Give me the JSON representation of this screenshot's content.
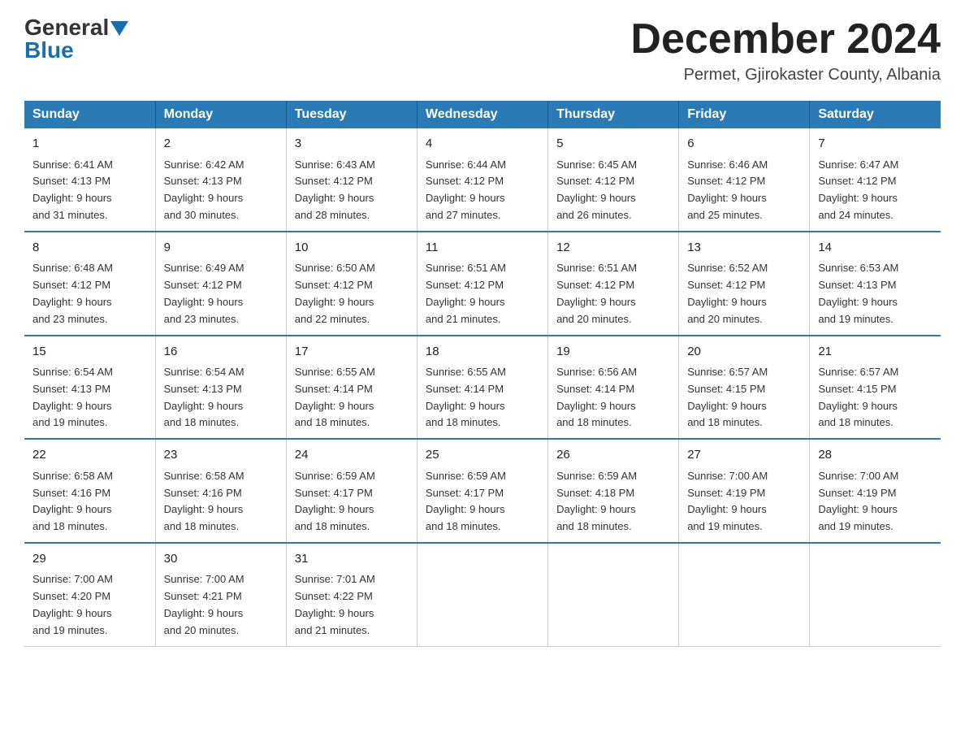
{
  "logo": {
    "general": "General",
    "blue": "Blue"
  },
  "title": "December 2024",
  "location": "Permet, Gjirokaster County, Albania",
  "days_of_week": [
    "Sunday",
    "Monday",
    "Tuesday",
    "Wednesday",
    "Thursday",
    "Friday",
    "Saturday"
  ],
  "weeks": [
    [
      {
        "day": "1",
        "sunrise": "6:41 AM",
        "sunset": "4:13 PM",
        "daylight": "9 hours and 31 minutes."
      },
      {
        "day": "2",
        "sunrise": "6:42 AM",
        "sunset": "4:13 PM",
        "daylight": "9 hours and 30 minutes."
      },
      {
        "day": "3",
        "sunrise": "6:43 AM",
        "sunset": "4:12 PM",
        "daylight": "9 hours and 28 minutes."
      },
      {
        "day": "4",
        "sunrise": "6:44 AM",
        "sunset": "4:12 PM",
        "daylight": "9 hours and 27 minutes."
      },
      {
        "day": "5",
        "sunrise": "6:45 AM",
        "sunset": "4:12 PM",
        "daylight": "9 hours and 26 minutes."
      },
      {
        "day": "6",
        "sunrise": "6:46 AM",
        "sunset": "4:12 PM",
        "daylight": "9 hours and 25 minutes."
      },
      {
        "day": "7",
        "sunrise": "6:47 AM",
        "sunset": "4:12 PM",
        "daylight": "9 hours and 24 minutes."
      }
    ],
    [
      {
        "day": "8",
        "sunrise": "6:48 AM",
        "sunset": "4:12 PM",
        "daylight": "9 hours and 23 minutes."
      },
      {
        "day": "9",
        "sunrise": "6:49 AM",
        "sunset": "4:12 PM",
        "daylight": "9 hours and 23 minutes."
      },
      {
        "day": "10",
        "sunrise": "6:50 AM",
        "sunset": "4:12 PM",
        "daylight": "9 hours and 22 minutes."
      },
      {
        "day": "11",
        "sunrise": "6:51 AM",
        "sunset": "4:12 PM",
        "daylight": "9 hours and 21 minutes."
      },
      {
        "day": "12",
        "sunrise": "6:51 AM",
        "sunset": "4:12 PM",
        "daylight": "9 hours and 20 minutes."
      },
      {
        "day": "13",
        "sunrise": "6:52 AM",
        "sunset": "4:12 PM",
        "daylight": "9 hours and 20 minutes."
      },
      {
        "day": "14",
        "sunrise": "6:53 AM",
        "sunset": "4:13 PM",
        "daylight": "9 hours and 19 minutes."
      }
    ],
    [
      {
        "day": "15",
        "sunrise": "6:54 AM",
        "sunset": "4:13 PM",
        "daylight": "9 hours and 19 minutes."
      },
      {
        "day": "16",
        "sunrise": "6:54 AM",
        "sunset": "4:13 PM",
        "daylight": "9 hours and 18 minutes."
      },
      {
        "day": "17",
        "sunrise": "6:55 AM",
        "sunset": "4:14 PM",
        "daylight": "9 hours and 18 minutes."
      },
      {
        "day": "18",
        "sunrise": "6:55 AM",
        "sunset": "4:14 PM",
        "daylight": "9 hours and 18 minutes."
      },
      {
        "day": "19",
        "sunrise": "6:56 AM",
        "sunset": "4:14 PM",
        "daylight": "9 hours and 18 minutes."
      },
      {
        "day": "20",
        "sunrise": "6:57 AM",
        "sunset": "4:15 PM",
        "daylight": "9 hours and 18 minutes."
      },
      {
        "day": "21",
        "sunrise": "6:57 AM",
        "sunset": "4:15 PM",
        "daylight": "9 hours and 18 minutes."
      }
    ],
    [
      {
        "day": "22",
        "sunrise": "6:58 AM",
        "sunset": "4:16 PM",
        "daylight": "9 hours and 18 minutes."
      },
      {
        "day": "23",
        "sunrise": "6:58 AM",
        "sunset": "4:16 PM",
        "daylight": "9 hours and 18 minutes."
      },
      {
        "day": "24",
        "sunrise": "6:59 AM",
        "sunset": "4:17 PM",
        "daylight": "9 hours and 18 minutes."
      },
      {
        "day": "25",
        "sunrise": "6:59 AM",
        "sunset": "4:17 PM",
        "daylight": "9 hours and 18 minutes."
      },
      {
        "day": "26",
        "sunrise": "6:59 AM",
        "sunset": "4:18 PM",
        "daylight": "9 hours and 18 minutes."
      },
      {
        "day": "27",
        "sunrise": "7:00 AM",
        "sunset": "4:19 PM",
        "daylight": "9 hours and 19 minutes."
      },
      {
        "day": "28",
        "sunrise": "7:00 AM",
        "sunset": "4:19 PM",
        "daylight": "9 hours and 19 minutes."
      }
    ],
    [
      {
        "day": "29",
        "sunrise": "7:00 AM",
        "sunset": "4:20 PM",
        "daylight": "9 hours and 19 minutes."
      },
      {
        "day": "30",
        "sunrise": "7:00 AM",
        "sunset": "4:21 PM",
        "daylight": "9 hours and 20 minutes."
      },
      {
        "day": "31",
        "sunrise": "7:01 AM",
        "sunset": "4:22 PM",
        "daylight": "9 hours and 21 minutes."
      },
      null,
      null,
      null,
      null
    ]
  ],
  "labels": {
    "sunrise": "Sunrise:",
    "sunset": "Sunset:",
    "daylight": "Daylight:"
  }
}
